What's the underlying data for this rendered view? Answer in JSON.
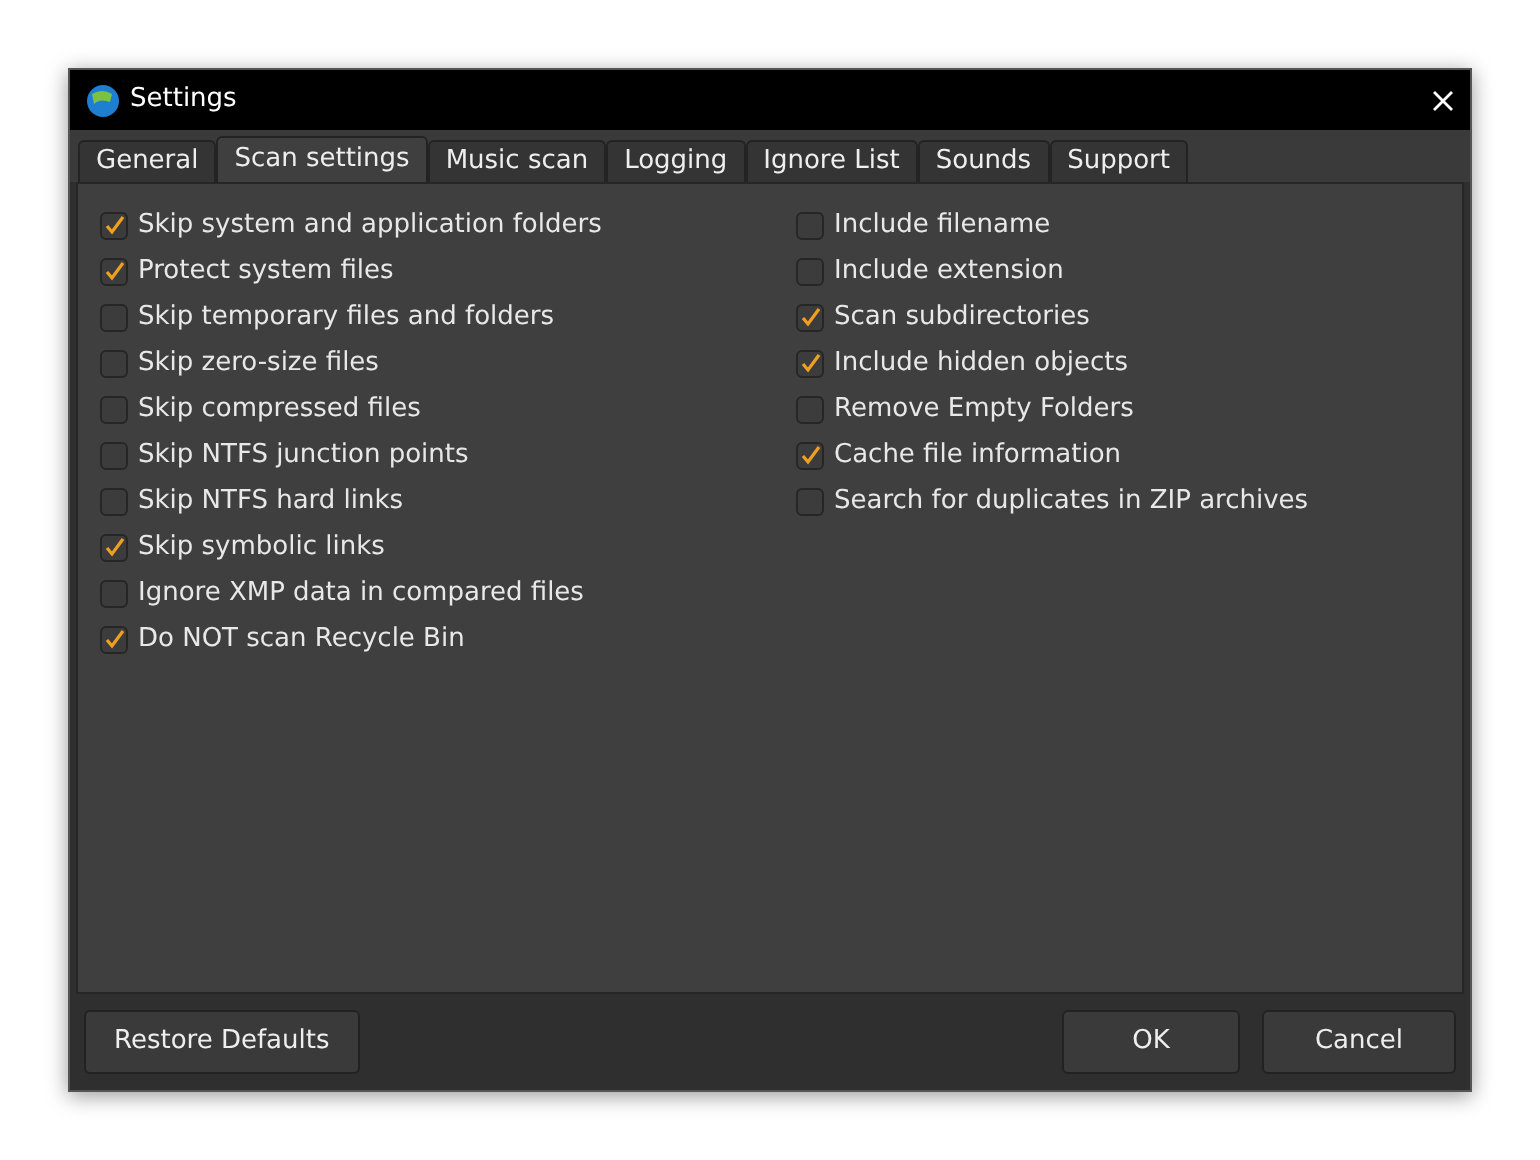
{
  "window": {
    "title": "Settings"
  },
  "tabs": [
    {
      "label": "General",
      "selected": false
    },
    {
      "label": "Scan settings",
      "selected": true
    },
    {
      "label": "Music scan",
      "selected": false
    },
    {
      "label": "Logging",
      "selected": false
    },
    {
      "label": "Ignore List",
      "selected": false
    },
    {
      "label": "Sounds",
      "selected": false
    },
    {
      "label": "Support",
      "selected": false
    }
  ],
  "left_options": [
    {
      "label": "Skip system and application folders",
      "checked": true
    },
    {
      "label": "Protect system files",
      "checked": true
    },
    {
      "label": "Skip temporary files and folders",
      "checked": false
    },
    {
      "label": "Skip zero-size files",
      "checked": false
    },
    {
      "label": "Skip compressed files",
      "checked": false
    },
    {
      "label": "Skip NTFS junction points",
      "checked": false
    },
    {
      "label": "Skip NTFS hard links",
      "checked": false
    },
    {
      "label": "Skip symbolic links",
      "checked": true
    },
    {
      "label": "Ignore XMP data in compared files",
      "checked": false
    },
    {
      "label": "Do NOT scan Recycle Bin",
      "checked": true
    }
  ],
  "right_options": [
    {
      "label": "Include filename",
      "checked": false
    },
    {
      "label": "Include extension",
      "checked": false
    },
    {
      "label": "Scan subdirectories",
      "checked": true
    },
    {
      "label": "Include hidden objects",
      "checked": true
    },
    {
      "label": "Remove Empty Folders",
      "checked": false
    },
    {
      "label": "Cache file information",
      "checked": true
    },
    {
      "label": "Search for duplicates in ZIP archives",
      "checked": false
    }
  ],
  "buttons": {
    "restore": "Restore Defaults",
    "ok": "OK",
    "cancel": "Cancel"
  }
}
